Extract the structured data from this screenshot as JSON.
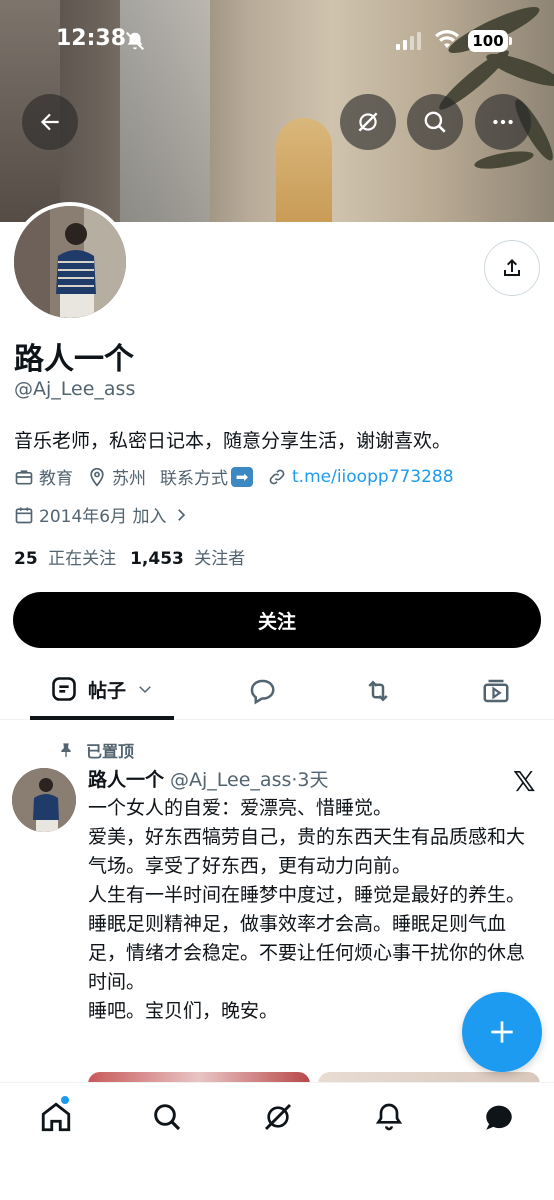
{
  "status_bar": {
    "time": "12:38",
    "battery": "100"
  },
  "profile": {
    "name": "路人一个",
    "handle": "@Aj_Lee_ass",
    "bio": "音乐老师，私密日记本，随意分享生活，谢谢喜欢。",
    "category": "教育",
    "location": "苏州",
    "contact": "联系方式",
    "contact_emoji": "➡",
    "link": "t.me/iioopp773288",
    "joined": "2014年6月 加入",
    "following_count": "25",
    "following_label": "正在关注",
    "followers_count": "1,453",
    "followers_label": "关注者",
    "follow_button": "关注"
  },
  "tabs": {
    "posts_label": "帖子"
  },
  "pinned_post": {
    "pinned_label": "已置顶",
    "author_name": "路人一个",
    "author_handle": "@Aj_Lee_ass",
    "time": "·3天",
    "lines": [
      "一个女人的自爱：爱漂亮、惜睡觉。",
      "爱美，好东西犒劳自己，贵的东西天生有品质感和大气场。享受了好东西，更有动力向前。",
      "人生有一半时间在睡梦中度过，睡觉是最好的养生。",
      "睡眠足则精神足，做事效率才会高。睡眠足则气血足，情绪才会稳定。不要让任何烦心事干扰你的休息时间。",
      "睡吧。宝贝们，晚安。"
    ]
  },
  "colors": {
    "accent": "#1d9bf0",
    "text": "#0f1419",
    "secondary": "#536471"
  },
  "icons": {
    "back": "arrow-left-icon",
    "grok": "grok-icon",
    "search": "search-icon",
    "more": "more-icon",
    "share": "share-icon",
    "home": "home-icon",
    "notifications": "bell-icon",
    "messages": "chat-icon"
  }
}
